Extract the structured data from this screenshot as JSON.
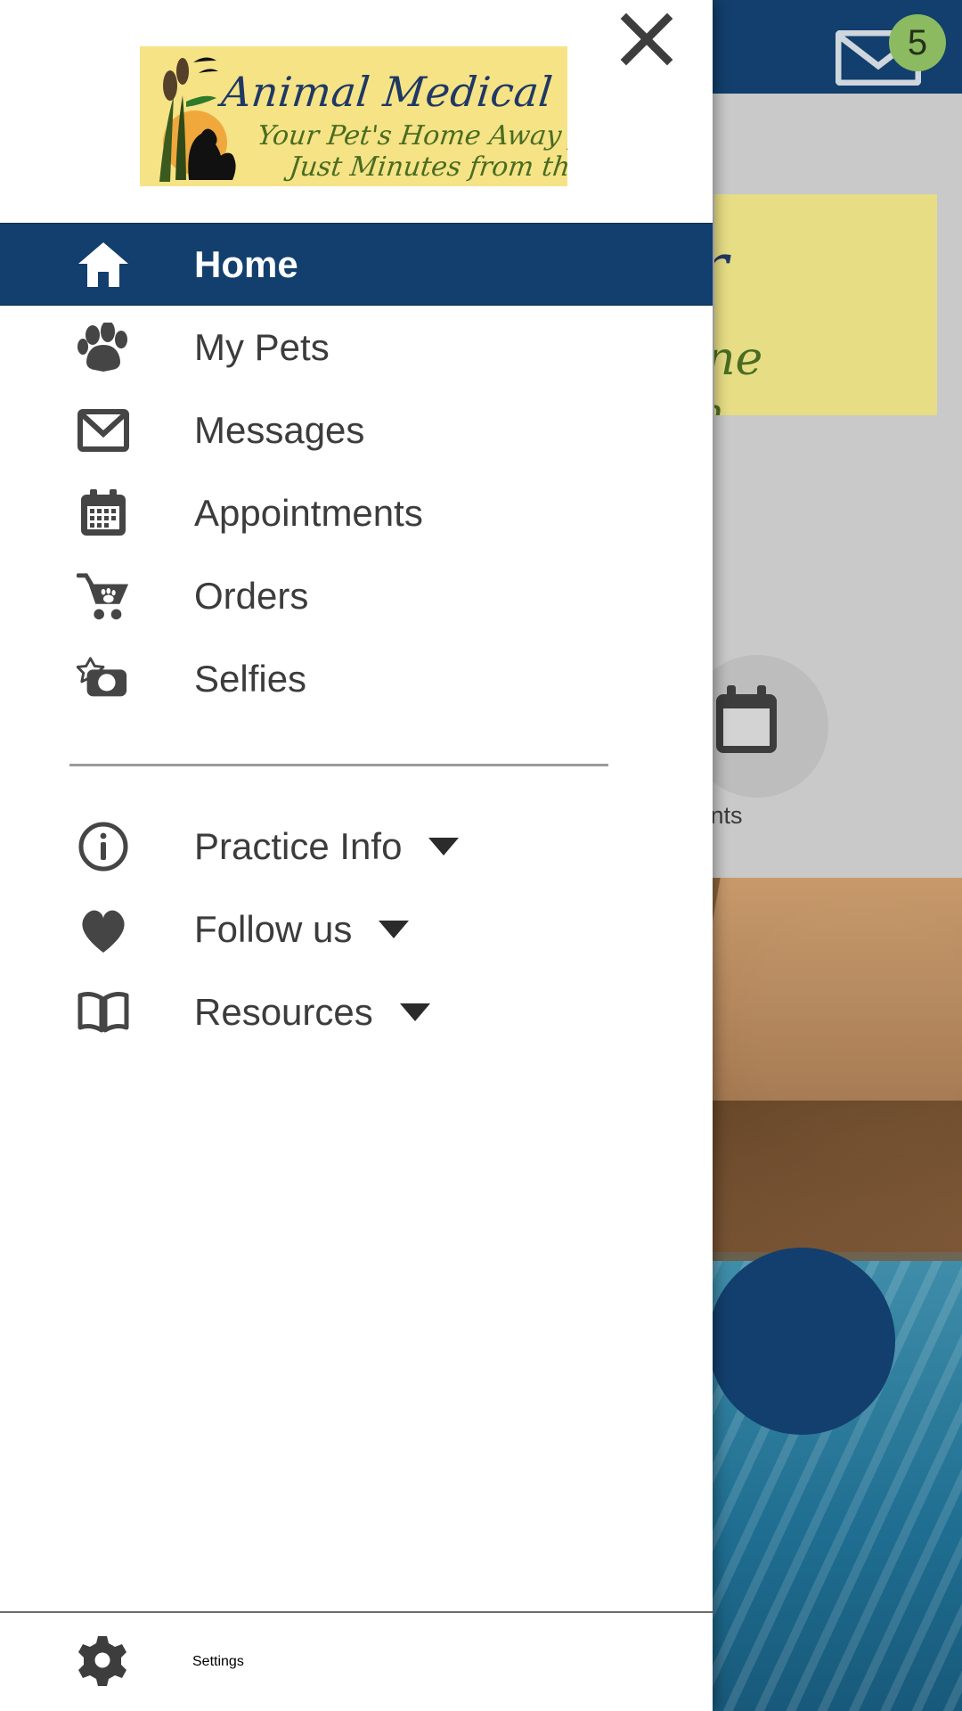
{
  "background": {
    "mail_icon": "mail-icon",
    "unread_badge": "5",
    "banner_line1": "r",
    "banner_line2": "ne",
    "banner_line3": "h",
    "tile_label": "ments",
    "topbar_color": "#123f6d",
    "badge_color": "#8cba60"
  },
  "drawer": {
    "close_icon": "close-icon",
    "logo": {
      "title": "Animal Medical Center",
      "tagline1": "Your Pet's Home Away from Home",
      "tagline2": "Just Minutes from the Beach",
      "background_color": "#f5e386",
      "title_color": "#1f3864",
      "tagline_color": "#4a6c21"
    },
    "active_color": "#123f6d",
    "items": [
      {
        "label": "Home",
        "icon": "home-icon",
        "active": true,
        "expandable": false
      },
      {
        "label": "My Pets",
        "icon": "paw-icon",
        "active": false,
        "expandable": false
      },
      {
        "label": "Messages",
        "icon": "envelope-icon",
        "active": false,
        "expandable": false
      },
      {
        "label": "Appointments",
        "icon": "calendar-icon",
        "active": false,
        "expandable": false
      },
      {
        "label": "Orders",
        "icon": "shopping-cart-paw-icon",
        "active": false,
        "expandable": false
      },
      {
        "label": "Selfies",
        "icon": "camera-star-icon",
        "active": false,
        "expandable": false
      }
    ],
    "secondary_items": [
      {
        "label": "Practice Info",
        "icon": "info-circle-icon",
        "expandable": true
      },
      {
        "label": "Follow us",
        "icon": "heart-icon",
        "expandable": true
      },
      {
        "label": "Resources",
        "icon": "book-open-icon",
        "expandable": true
      }
    ],
    "footer_item": {
      "label": "Settings",
      "icon": "gear-icon"
    }
  }
}
